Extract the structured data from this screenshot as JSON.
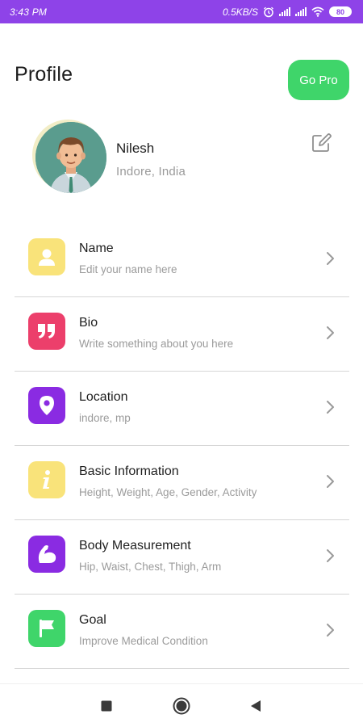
{
  "status_bar": {
    "time": "3:43 PM",
    "network_speed": "0.5KB/S",
    "battery": "80"
  },
  "header": {
    "title": "Profile",
    "go_pro_label": "Go Pro"
  },
  "profile": {
    "name": "Nilesh",
    "location": "Indore, India"
  },
  "menu": {
    "items": [
      {
        "title": "Name",
        "subtitle": "Edit your name here",
        "icon": "user-icon",
        "color": "#f9e37a"
      },
      {
        "title": "Bio",
        "subtitle": "Write something about you here",
        "icon": "quote-icon",
        "color": "#ec3f6b"
      },
      {
        "title": "Location",
        "subtitle": "indore, mp",
        "icon": "location-pin-icon",
        "color": "#8a2be2"
      },
      {
        "title": "Basic Information",
        "subtitle": "Height, Weight, Age, Gender, Activity",
        "icon": "info-icon",
        "color": "#f9e37a"
      },
      {
        "title": "Body Measurement",
        "subtitle": "Hip, Waist, Chest, Thigh, Arm",
        "icon": "bicep-icon",
        "color": "#8a2be2"
      },
      {
        "title": "Goal",
        "subtitle": "Improve Medical Condition",
        "icon": "flag-icon",
        "color": "#3fd56a"
      }
    ]
  },
  "colors": {
    "status_bar": "#8e43e8",
    "go_pro": "#3fd56a",
    "divider": "#d6d6d6"
  }
}
